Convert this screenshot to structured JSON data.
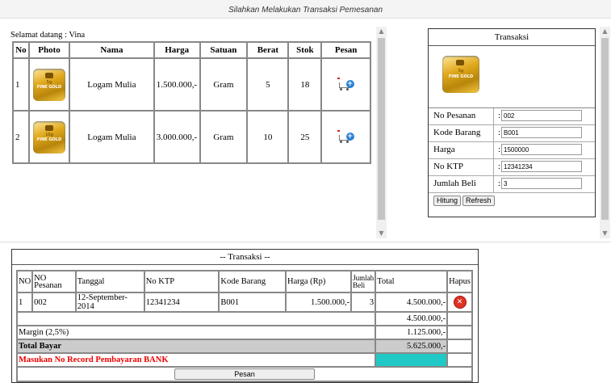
{
  "header": {
    "title": "Silahkan Melakukan Transaksi Pemesanan"
  },
  "welcome": "Selamat datang : Vina",
  "products": {
    "columns": [
      "No",
      "Photo",
      "Nama",
      "Harga",
      "Satuan",
      "Berat",
      "Stok",
      "Pesan"
    ],
    "rows": [
      {
        "no": "1",
        "photo_icon": "gold-bar-5g-icon",
        "bar_weight": "5g",
        "bar_brand": "FINE GOLD",
        "nama": "Logam Mulia",
        "harga": "1.500.000,-",
        "satuan": "Gram",
        "berat": "5",
        "stok": "18",
        "pesan_icon": "add-to-cart-icon"
      },
      {
        "no": "2",
        "photo_icon": "gold-bar-10g-icon",
        "bar_weight": "10g",
        "bar_brand": "FINE GOLD",
        "nama": "Logam Mulia",
        "harga": "3.000.000,-",
        "satuan": "Gram",
        "berat": "10",
        "stok": "25",
        "pesan_icon": "add-to-cart-icon"
      }
    ]
  },
  "transaksi_form": {
    "title": "Transaksi",
    "photo": {
      "bar_weight": "5g",
      "bar_brand": "FINE GOLD"
    },
    "fields": [
      {
        "label": "No Pesanan",
        "colon": ":",
        "value": "002"
      },
      {
        "label": "Kode Barang",
        "colon": ":",
        "value": "B001"
      },
      {
        "label": "Harga",
        "colon": ":",
        "value": "1500000"
      },
      {
        "label": "No KTP",
        "colon": ":",
        "value": "12341234"
      },
      {
        "label": "Jumlah Beli",
        "colon": ":",
        "value": "3"
      }
    ],
    "buttons": {
      "hitung": "Hitung",
      "refresh": "Refresh"
    }
  },
  "transaksi_table": {
    "title": "-- Transaksi --",
    "columns": [
      "NO",
      "NO Pesanan",
      "Tanggal",
      "No KTP",
      "Kode Barang",
      "Harga (Rp)",
      "Jumlah Beli",
      "Total",
      "Hapus"
    ],
    "rows": [
      {
        "no": "1",
        "no_pesanan": "002",
        "tanggal": "12-September-2014",
        "no_ktp": "12341234",
        "kode_barang": "B001",
        "harga": "1.500.000,-",
        "jumlah": "3",
        "total": "4.500.000,-",
        "hapus_icon": "delete-icon"
      }
    ],
    "subtotal": "4.500.000,-",
    "margin_label": "Margin (2,5%)",
    "margin_value": "1.125.000,-",
    "total_label": "Total Bayar",
    "total_value": "5.625.000,-",
    "bank_prompt": "Masukan No Record Pembayaran BANK",
    "pesan_button": "Pesan"
  },
  "colors": {
    "accent_cyan": "#20c9c6",
    "prompt_red": "#e00000",
    "delete_red": "#d33322"
  }
}
